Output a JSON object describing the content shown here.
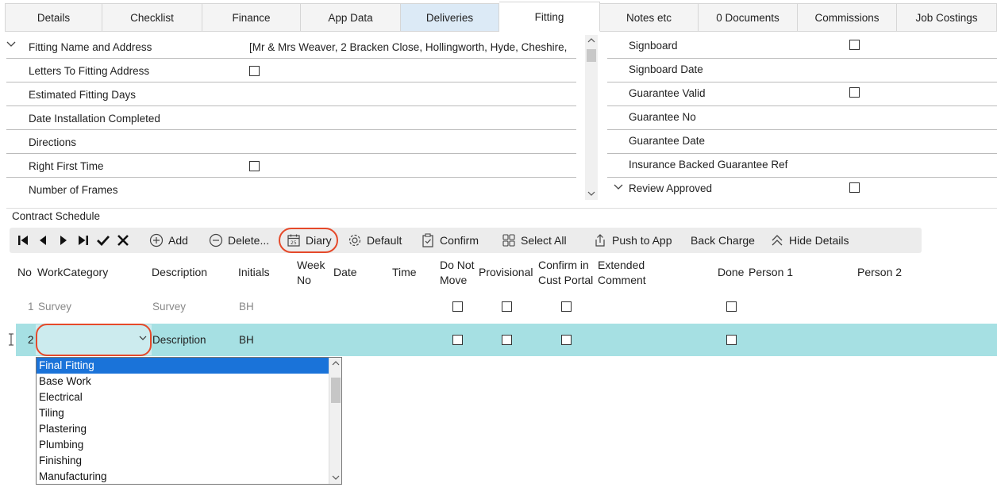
{
  "tabs": [
    {
      "label": "Details"
    },
    {
      "label": "Checklist"
    },
    {
      "label": "Finance"
    },
    {
      "label": "App Data"
    },
    {
      "label": "Deliveries"
    },
    {
      "label": "Fitting"
    },
    {
      "label": "Notes etc"
    },
    {
      "label": "0 Documents"
    },
    {
      "label": "Commissions"
    },
    {
      "label": "Job Costings"
    }
  ],
  "active_tab": "Fitting",
  "left_fields": [
    {
      "label": "Fitting Name and Address",
      "value": "[Mr & Mrs  Weaver, 2 Bracken Close, Hollingworth, Hyde, Cheshire,"
    },
    {
      "label": "Letters To Fitting Address",
      "checked": false
    },
    {
      "label": "Estimated Fitting Days",
      "value": ""
    },
    {
      "label": "Date Installation Completed",
      "value": ""
    },
    {
      "label": "Directions",
      "value": ""
    },
    {
      "label": "Right First Time",
      "checked": false
    },
    {
      "label": "Number of Frames",
      "value": ""
    }
  ],
  "right_fields": [
    {
      "label": "Signboard",
      "checked": false
    },
    {
      "label": "Signboard Date"
    },
    {
      "label": "Guarantee Valid",
      "checked": false
    },
    {
      "label": "Guarantee No"
    },
    {
      "label": "Guarantee Date"
    },
    {
      "label": "Insurance Backed Guarantee Ref"
    },
    {
      "label": "Review Approved",
      "checked": false
    }
  ],
  "section_title": "Contract Schedule",
  "toolbar": {
    "add": "Add",
    "delete": "Delete...",
    "diary": "Diary",
    "default": "Default",
    "confirm": "Confirm",
    "select_all": "Select All",
    "push_to_app": "Push to App",
    "back_charge": "Back Charge",
    "hide_details": "Hide Details"
  },
  "grid_headers": {
    "no": "No",
    "work_category": "WorkCategory",
    "description": "Description",
    "initials": "Initials",
    "week_no_1": "Week",
    "week_no_2": "No",
    "date": "Date",
    "time": "Time",
    "do_not_move_1": "Do Not",
    "do_not_move_2": "Move",
    "provisional": "Provisional",
    "confirm_portal_1": "Confirm in",
    "confirm_portal_2": "Cust Portal",
    "extended_comment_1": "Extended",
    "extended_comment_2": "Comment",
    "done": "Done",
    "person1": "Person 1",
    "person2": "Person 2"
  },
  "rows": [
    {
      "no": "1",
      "work_category": "Survey",
      "description": "Survey",
      "initials": "BH"
    },
    {
      "no": "2",
      "work_category": "",
      "description": "Description",
      "initials": "BH"
    }
  ],
  "dropdown_options": [
    "Final Fitting",
    "Base Work",
    "Electrical",
    "Tiling",
    "Plastering",
    "Plumbing",
    "Finishing",
    "Manufacturing"
  ],
  "dropdown_selected": "Final Fitting",
  "colors": {
    "highlight_ring": "#e5492a",
    "selected_row": "#a6e0e3",
    "dropdown_selection": "#1a73d9",
    "deliveries_tab": "#dceaf6"
  }
}
